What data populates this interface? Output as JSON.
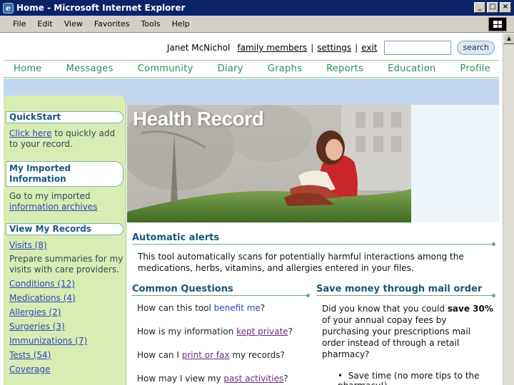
{
  "window": {
    "title": "Home - Microsoft Internet Explorer",
    "buttons": [
      "_",
      "□",
      "×"
    ]
  },
  "menu": [
    "File",
    "Edit",
    "View",
    "Favorites",
    "Tools",
    "Help"
  ],
  "userbar": {
    "user_name": "Janet McNichol",
    "family_members": "family members",
    "settings": "settings",
    "exit": "exit",
    "separator": "|",
    "search_value": "",
    "search_button": "search"
  },
  "nav": [
    "Home",
    "Messages",
    "Community",
    "Diary",
    "Graphs",
    "Reports",
    "Education",
    "Profile"
  ],
  "sidebar": {
    "quickstart": {
      "title": "QuickStart",
      "link": "Click here",
      "text": " to quickly add to your record."
    },
    "imported": {
      "title_line1": "My Imported",
      "title_line2": "Information",
      "text": "Go to my imported ",
      "link": "information archives"
    },
    "records": {
      "title": "View My Records",
      "visits": "Visits (8)",
      "visits_desc": "Prepare summaries for my visits with care providers.",
      "items": [
        "Conditions (12)",
        "Medications (4)",
        "Allergies (2)",
        "Surgeries (3)",
        "Immunizations (7)",
        "Tests (54)",
        "Coverage"
      ]
    }
  },
  "hero": {
    "title": "Health Record"
  },
  "alerts": {
    "heading": "Automatic alerts",
    "text": "This tool automatically scans for potentially harmful interactions among the medications, herbs, vitamins, and allergies entered in your files."
  },
  "questions": {
    "heading": "Common Questions",
    "q1_pre": "How can this tool ",
    "q1_hl": "benefit me",
    "q1_post": "?",
    "q2_pre": "How is my information ",
    "q2_link": "kept private",
    "q2_post": "?",
    "q3_pre": "How can I ",
    "q3_link": "print or fax",
    "q3_post": " my records?",
    "q4_pre": "How may I view my ",
    "q4_link": "past activities",
    "q4_post": "?"
  },
  "mailorder": {
    "heading": "Save money through mail order",
    "text_pre": "Did you know that you could ",
    "text_bold": "save 30%",
    "text_post": " of your annual copay fees by purchasing your prescriptions mail order instead of through a retail pharmacy?",
    "bullet": "Save time (no more tips to the pharmacy!)"
  },
  "colors": {
    "nav_text": "#2c8b6a",
    "sidebar_bg": "#d9ecb4",
    "heading": "#17577a",
    "link": "#2a47b8",
    "band": "#c3d8f0"
  }
}
